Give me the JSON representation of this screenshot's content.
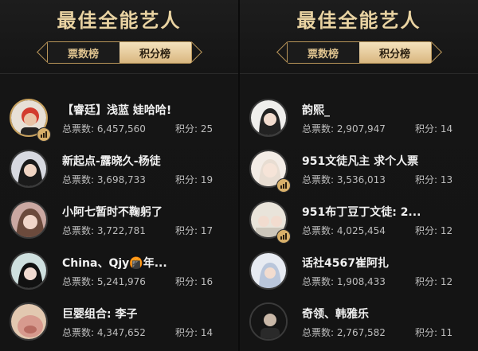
{
  "left": {
    "title": "最佳全能艺人",
    "tabs": [
      "票数榜",
      "积分榜"
    ],
    "items": [
      {
        "name": "【睿廷】浅蓝 娃哈哈!",
        "votes": "总票数: 6,457,560",
        "score": "积分: 25"
      },
      {
        "name": "新起点-露晓久-杨徒",
        "votes": "总票数: 3,698,733",
        "score": "积分: 19"
      },
      {
        "name": "小阿七暂时不鞠躬了",
        "votes": "总票数: 3,722,781",
        "score": "积分: 17"
      },
      {
        "name": "China、Qjy🍘年...",
        "votes": "总票数: 5,241,976",
        "score": "积分: 16"
      },
      {
        "name": "巨婴组合: 李子",
        "votes": "总票数: 4,347,652",
        "score": "积分: 14"
      }
    ]
  },
  "right": {
    "title": "最佳全能艺人",
    "tabs": [
      "票数榜",
      "积分榜"
    ],
    "items": [
      {
        "name": "韵熙_",
        "votes": "总票数: 2,907,947",
        "score": "积分: 14"
      },
      {
        "name": "951文徒凡主 求个人票",
        "votes": "总票数: 3,536,013",
        "score": "积分: 13"
      },
      {
        "name": "951布丁豆丁文徒: 2...",
        "votes": "总票数: 4,025,454",
        "score": "积分: 12"
      },
      {
        "name": "话社4567崔阿扎",
        "votes": "总票数: 1,908,433",
        "score": "积分: 12"
      },
      {
        "name": "奇领、韩雅乐",
        "votes": "总票数: 2,767,582",
        "score": "积分: 11"
      }
    ]
  }
}
